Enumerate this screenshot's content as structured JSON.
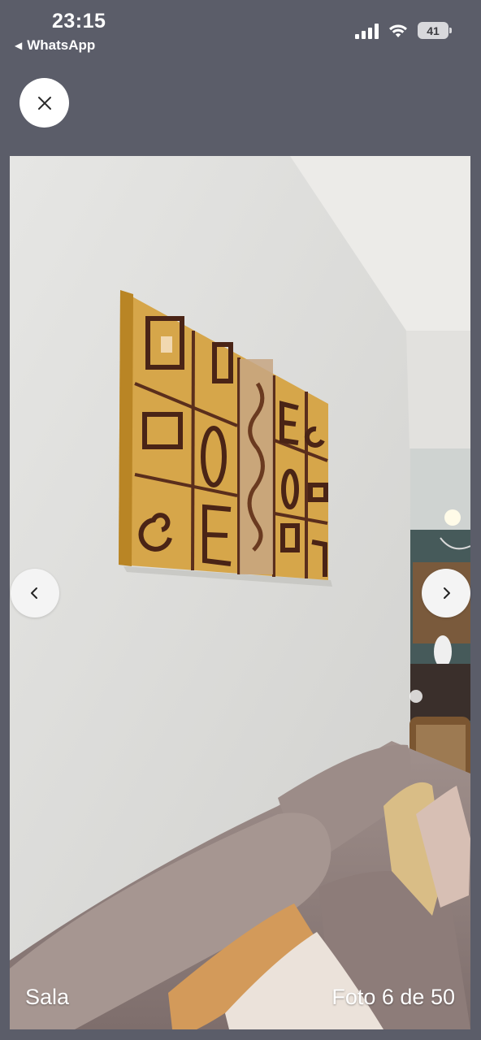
{
  "status_bar": {
    "time": "23:15",
    "back_app": "WhatsApp",
    "battery": "41",
    "icons": [
      "signal-icon",
      "wifi-icon",
      "battery-icon"
    ]
  },
  "viewer": {
    "close_icon": "close-icon",
    "prev_icon": "chevron-left-icon",
    "next_icon": "chevron-right-icon",
    "caption": "Sala",
    "counter": "Foto 6 de 50"
  },
  "colors": {
    "background": "#5b5d69",
    "button_bg": "#ffffff",
    "text": "#ffffff"
  }
}
